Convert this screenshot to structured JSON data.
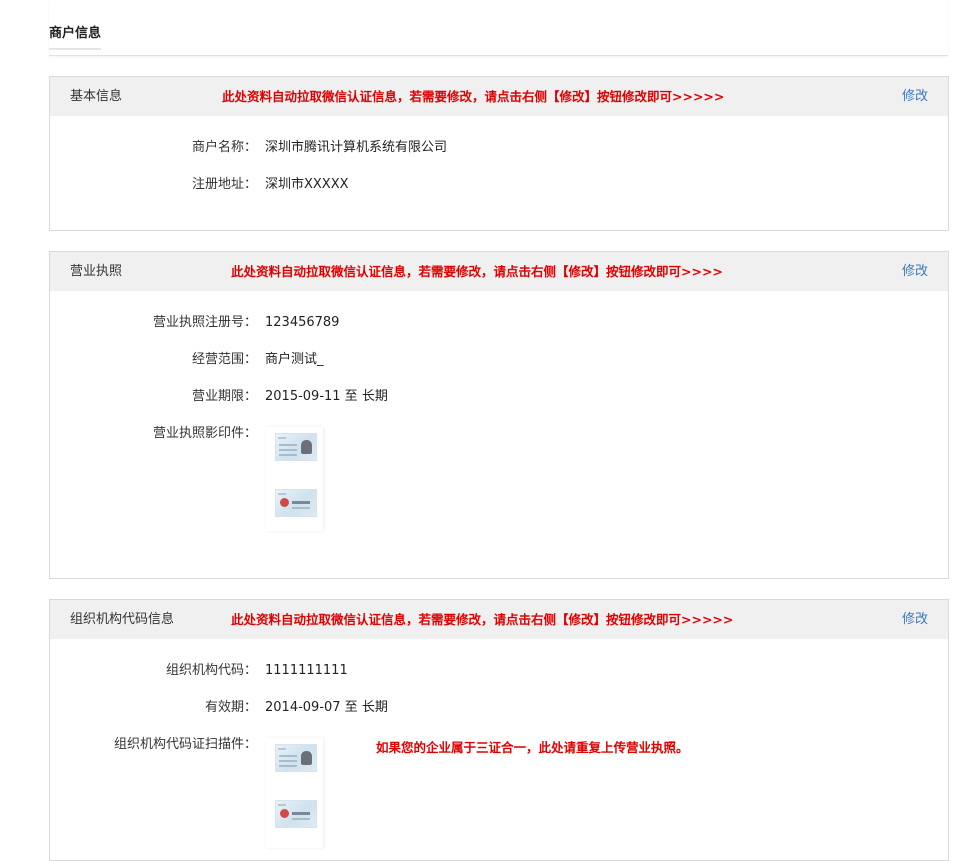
{
  "page": {
    "title": "商户信息"
  },
  "basic": {
    "title": "基本信息",
    "notice": "此处资料自动拉取微信认证信息，若需要修改，请点击右侧【修改】按钮修改即可>>>>>",
    "edit": "修改",
    "fields": [
      {
        "label": "商户名称：",
        "value": "深圳市腾讯计算机系统有限公司"
      },
      {
        "label": "注册地址：",
        "value": "深圳市XXXXX"
      }
    ]
  },
  "license": {
    "title": "营业执照",
    "notice": "此处资料自动拉取微信认证信息，若需要修改，请点击右侧【修改】按钮修改即可>>>>",
    "edit": "修改",
    "fields": [
      {
        "label": "营业执照注册号：",
        "value": "123456789"
      },
      {
        "label": "经营范围：",
        "value": "商户测试_"
      },
      {
        "label": "营业期限：",
        "value": "2015-09-11 至 长期"
      },
      {
        "label": "营业执照影印件：",
        "value": ""
      }
    ]
  },
  "org": {
    "title": "组织机构代码信息",
    "notice": "此处资料自动拉取微信认证信息，若需要修改，请点击右侧【修改】按钮修改即可>>>>>",
    "edit": "修改",
    "fields": [
      {
        "label": "组织机构代码：",
        "value": "1111111111"
      },
      {
        "label": "有效期：",
        "value": "2014-09-07 至 长期"
      },
      {
        "label": "组织机构代码证扫描件：",
        "value": ""
      }
    ],
    "note": "如果您的企业属于三证合一，此处请重复上传营业执照。"
  },
  "icons": {
    "thumbnail": "id-card-image-icon"
  },
  "colors": {
    "notice": "#e00000",
    "link": "#3a78c3",
    "header_bg": "#f0f0f0"
  }
}
